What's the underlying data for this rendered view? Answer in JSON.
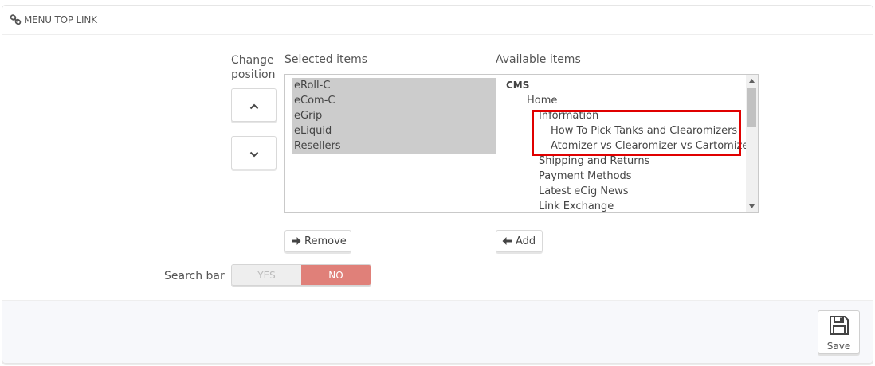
{
  "panel": {
    "title": "MENU TOP LINK",
    "title_icon": "link-icon"
  },
  "labels": {
    "change_position_line1": "Change",
    "change_position_line2": "position",
    "selected_items": "Selected items",
    "available_items": "Available items",
    "search_bar": "Search bar"
  },
  "selected_items": [
    "eRoll-C",
    "eCom-C",
    "eGrip",
    "eLiquid",
    "Resellers"
  ],
  "available_items": [
    {
      "label": "CMS",
      "level": 0
    },
    {
      "label": "Home",
      "level": 1
    },
    {
      "label": "Information",
      "level": 2
    },
    {
      "label": "How To Pick Tanks and Clearomizers",
      "level": 3
    },
    {
      "label": "Atomizer vs Clearomizer vs Cartomizer",
      "level": 3
    },
    {
      "label": "Shipping and Returns",
      "level": 2
    },
    {
      "label": "Payment Methods",
      "level": 2
    },
    {
      "label": "Latest eCig News",
      "level": 2
    },
    {
      "label": "Link Exchange",
      "level": 2
    }
  ],
  "buttons": {
    "move_up_icon": "chevron-up-icon",
    "move_down_icon": "chevron-down-icon",
    "remove": "Remove",
    "remove_icon": "arrow-right-icon",
    "add": "Add",
    "add_icon": "arrow-left-icon",
    "save": "Save",
    "save_icon": "floppy-disk-icon"
  },
  "search_bar_toggle": {
    "yes": "YES",
    "no": "NO",
    "selected": "NO"
  },
  "colors": {
    "toggle_no_active": "#e08079",
    "highlight_box": "#e00000",
    "selected_row_bg": "#cccccc"
  }
}
